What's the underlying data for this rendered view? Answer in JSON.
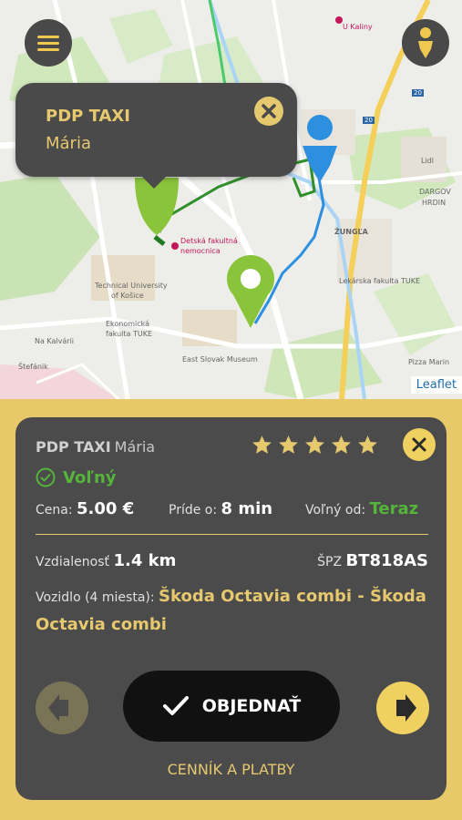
{
  "map": {
    "labels": {
      "u_kaliny": "U Kaliny",
      "lidl": "Lidl",
      "dargovskych_hrdinov": "DARGOV",
      "dargov2": "HRDIN",
      "zungla": "ŽUNGĽA",
      "lekarska": "Lekárska fakulta TUKE",
      "technical_univ": "Technical University",
      "of_kosice": "of Košice",
      "ekonomicka": "Ekonomická",
      "fakulta": "fakulta TUKE",
      "east_slovak": "East Slovak Museum",
      "pizza": "Pizza Marin",
      "detska": "Detská fakultná",
      "nemocnica": "nemocnica",
      "kalvaria": "Na Kalvárii",
      "stefanik": "Štefánik",
      "road20": "20",
      "road20b": "20"
    },
    "attribution": "Leaflet"
  },
  "popup": {
    "title": "PDP TAXI",
    "driver": "Mária"
  },
  "card": {
    "company": "PDP TAXI",
    "driver": "Mária",
    "rating": 5,
    "status": "Voľný",
    "price_label": "Cena:",
    "price_value": "5.00 €",
    "arrive_label": "Príde o:",
    "arrive_value": "8 min",
    "free_label": "Voľný od:",
    "free_value": "Teraz",
    "distance_label": "Vzdialenosť",
    "distance_value": "1.4 km",
    "plate_label": "ŠPZ",
    "plate_value": "BT818AS",
    "vehicle_label": "Vozidlo (4 miesta):",
    "vehicle_value": "Škoda Octavia combi - Škoda Octavia combi",
    "order_label": "OBJEDNAŤ",
    "pricing_link": "CENNÍK A PLATBY"
  },
  "colors": {
    "accent": "#e6c86e",
    "card_bg": "#4b4b4b",
    "green": "#55b43a",
    "page_bg": "#e7c96a"
  },
  "icons": {
    "menu": "hamburger-icon",
    "user": "user-pin-icon",
    "close": "close-icon",
    "star": "star-icon",
    "check": "check-circle-icon",
    "prev": "arrow-left-icon",
    "next": "arrow-right-icon"
  }
}
